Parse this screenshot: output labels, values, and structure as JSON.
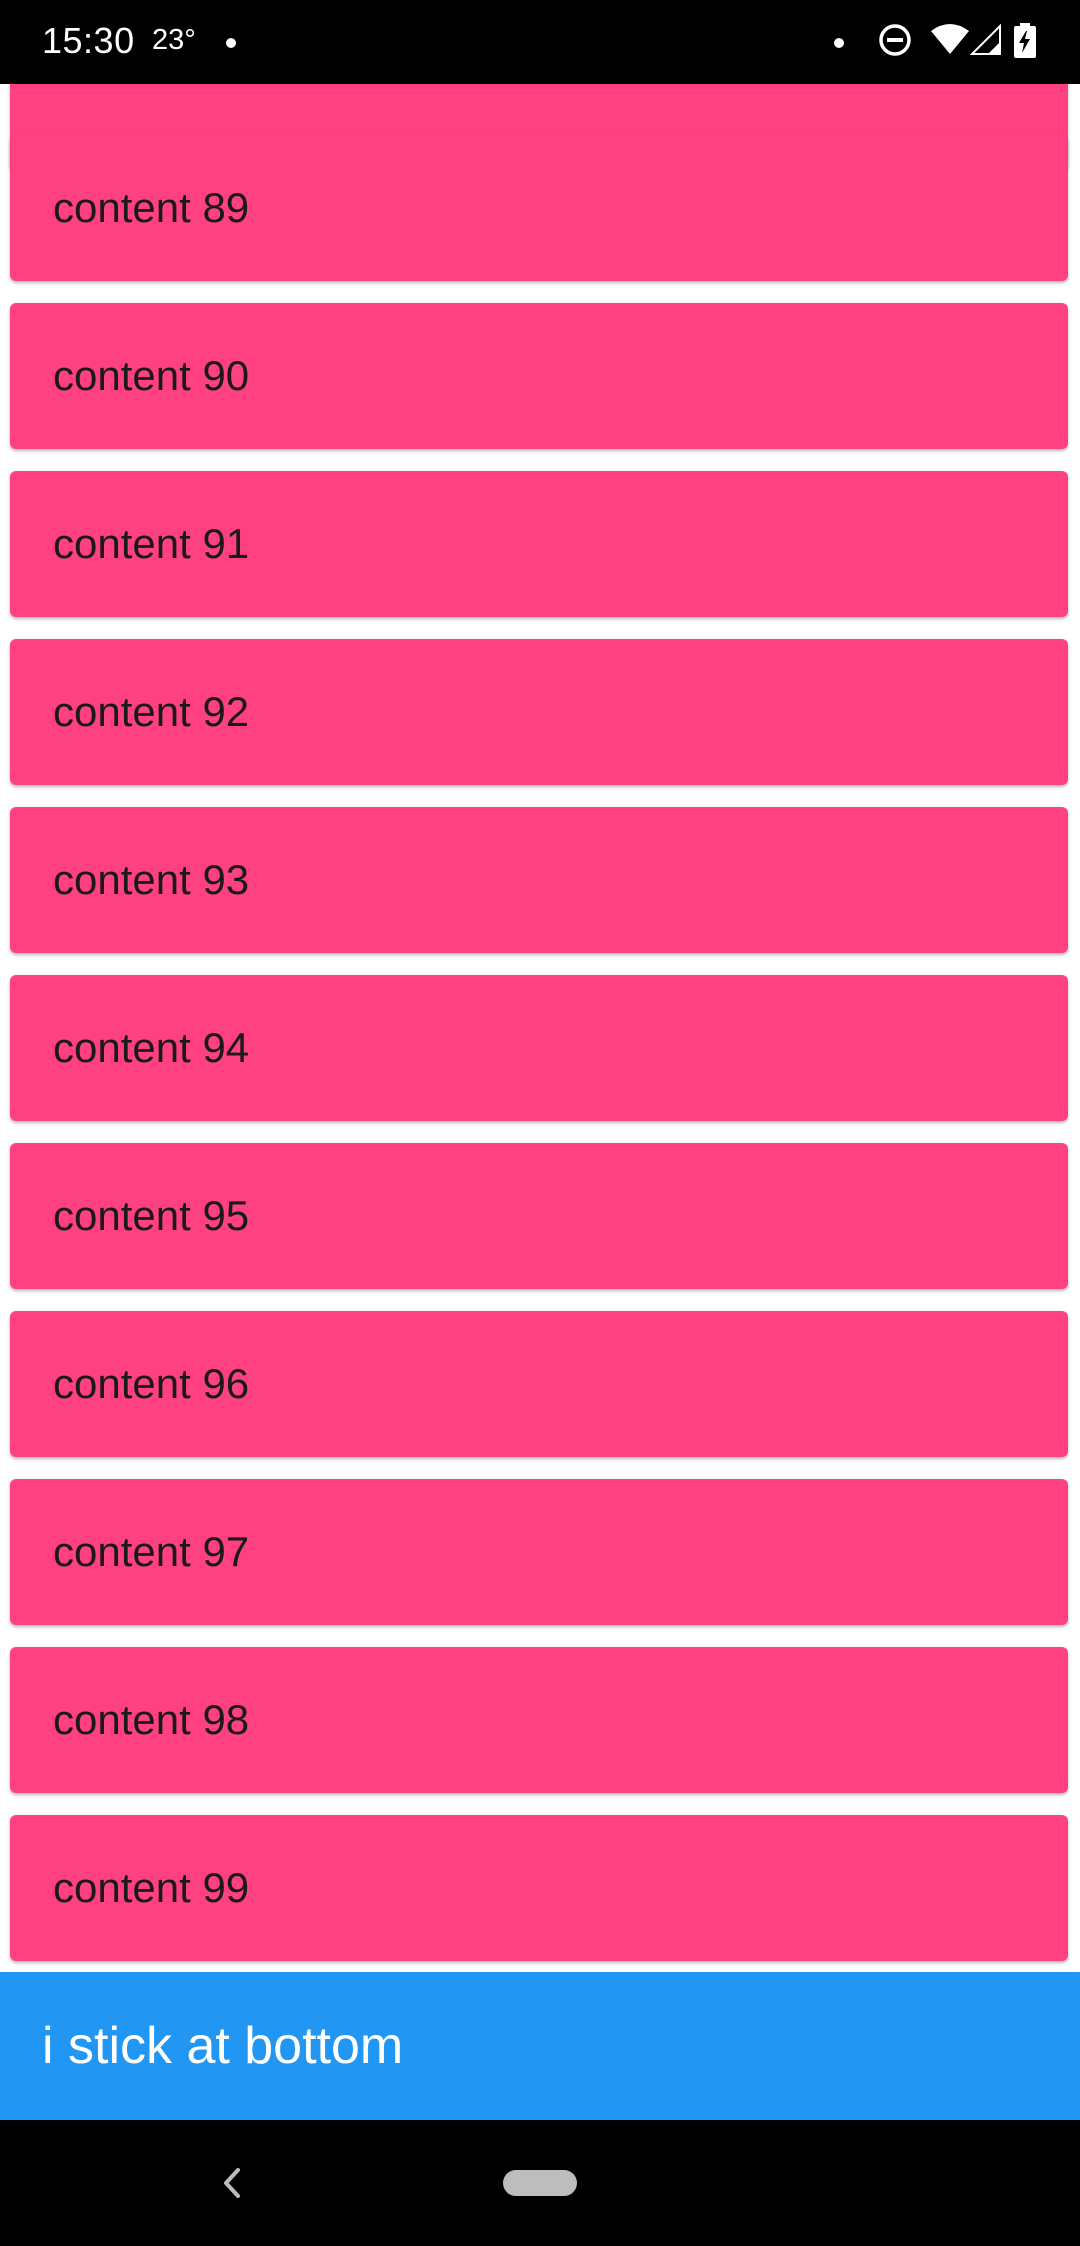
{
  "status_bar": {
    "time": "15:30",
    "temperature": "23°",
    "icons": [
      "notification-dot-icon",
      "do-not-disturb-icon",
      "wifi-icon",
      "cell-signal-icon",
      "battery-charging-icon"
    ]
  },
  "list": {
    "items": [
      {
        "label": ""
      },
      {
        "label": "content 89"
      },
      {
        "label": "content 90"
      },
      {
        "label": "content 91"
      },
      {
        "label": "content 92"
      },
      {
        "label": "content 93"
      },
      {
        "label": "content 94"
      },
      {
        "label": "content 95"
      },
      {
        "label": "content 96"
      },
      {
        "label": "content 97"
      },
      {
        "label": "content 98"
      },
      {
        "label": "content 99"
      }
    ]
  },
  "bottom_bar": {
    "label": "i stick at bottom"
  },
  "nav_bar": {
    "icons": [
      "back-icon",
      "home-pill-icon"
    ]
  },
  "colors": {
    "card": "#FF4081",
    "bottom_bar": "#2196F3",
    "status_bar": "#000000",
    "nav_bar": "#000000"
  }
}
